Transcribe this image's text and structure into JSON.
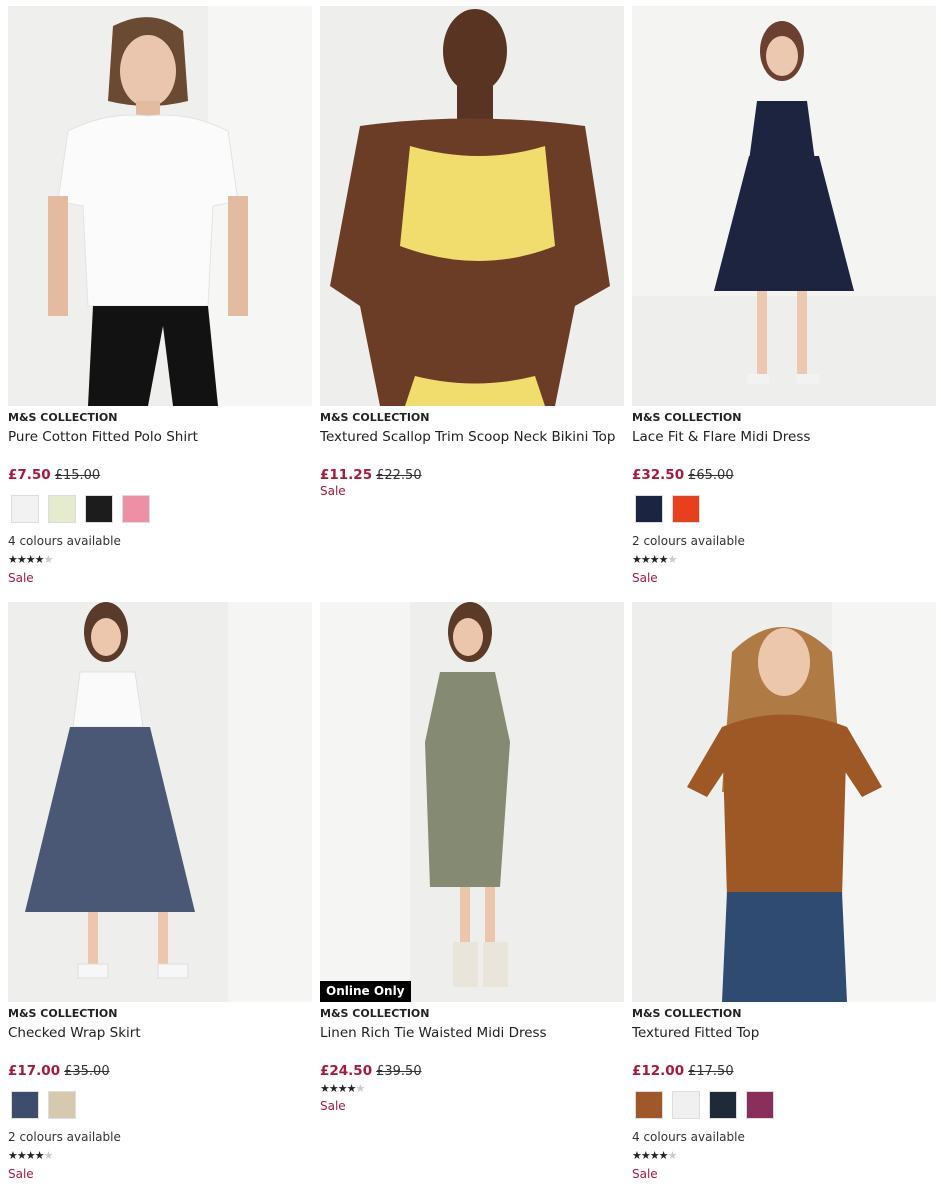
{
  "products": [
    {
      "brand": "M&S COLLECTION",
      "name": "Pure Cotton Fitted Polo Shirt",
      "price_now": "£7.50",
      "price_was": "£15.00",
      "swatch_colors": [
        "#f2f2f2",
        "#e4ebcf",
        "#1c1c1c",
        "#ef8fa5"
      ],
      "colours_text": "4 colours available",
      "rating": 4,
      "sale_text": "Sale",
      "image_icon": "polo-shirt-photo"
    },
    {
      "brand": "M&S COLLECTION",
      "name": "Textured Scallop Trim Scoop Neck Bikini Top",
      "price_now": "£11.25",
      "price_was": "£22.50",
      "sale_text": "Sale",
      "image_icon": "bikini-top-photo"
    },
    {
      "brand": "M&S COLLECTION",
      "name": "Lace Fit & Flare Midi Dress",
      "price_now": "£32.50",
      "price_was": "£65.00",
      "swatch_colors": [
        "#1b2440",
        "#e8401c"
      ],
      "colours_text": "2 colours available",
      "rating": 4,
      "sale_text": "Sale",
      "image_icon": "lace-dress-photo"
    },
    {
      "brand": "M&S COLLECTION",
      "name": "Checked Wrap Skirt",
      "price_now": "£17.00",
      "price_was": "£35.00",
      "swatch_colors": [
        "#3e4d6b",
        "#d6c9b0"
      ],
      "colours_text": "2 colours available",
      "rating": 4,
      "sale_text": "Sale",
      "image_icon": "wrap-skirt-photo"
    },
    {
      "brand": "M&S COLLECTION",
      "name": "Linen Rich Tie Waisted Midi Dress",
      "price_now": "£24.50",
      "price_was": "£39.50",
      "rating": 4,
      "sale_text": "Sale",
      "badge": "Online Only",
      "image_icon": "linen-dress-photo"
    },
    {
      "brand": "M&S COLLECTION",
      "name": "Textured Fitted Top",
      "price_now": "£12.00",
      "price_was": "£17.50",
      "swatch_colors": [
        "#a0582a",
        "#f0f0f0",
        "#1e2a38",
        "#8a2f5c"
      ],
      "colours_text": "4 colours available",
      "rating": 4,
      "sale_text": "Sale",
      "image_icon": "fitted-top-photo"
    }
  ],
  "colors": {
    "price_red": "#a7193e",
    "photo_bg": "#eeeeec"
  }
}
